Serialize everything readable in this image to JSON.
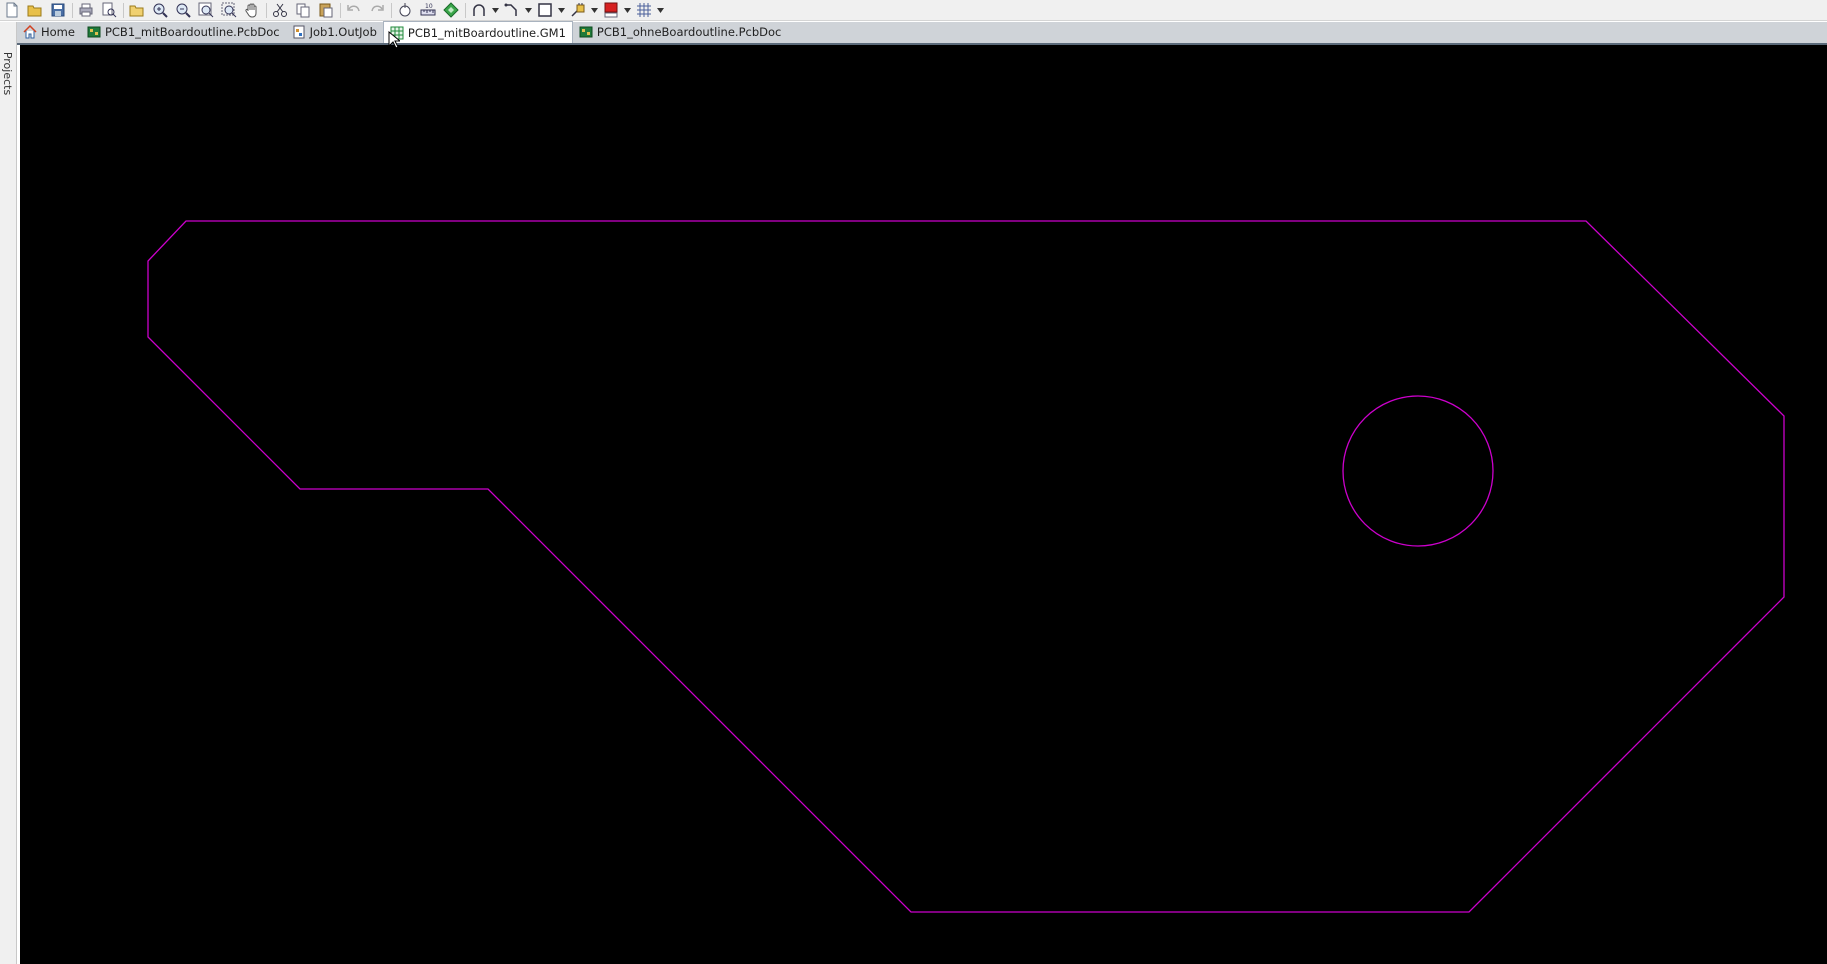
{
  "toolbar": {
    "buttons": [
      "new-file-icon",
      "open-file-icon",
      "save-icon",
      "print-icon",
      "print-preview-icon",
      "open-folder-icon",
      "zoom-in-icon",
      "zoom-out-icon",
      "zoom-fit-icon",
      "zoom-area-icon",
      "pan-hand-icon",
      "cut-icon",
      "copy-icon",
      "paste-icon",
      "undo-icon",
      "redo-icon",
      "cross-probe-icon",
      "measure-icon",
      "layer-icon",
      "arc-icon",
      "route-icon",
      "rectangle-icon",
      "component-icon",
      "color-icon",
      "grid-icon"
    ]
  },
  "side_panel": {
    "projects_label": "Projects"
  },
  "tabs": [
    {
      "label": "Home",
      "icon": "home-icon",
      "active": false
    },
    {
      "label": "PCB1_mitBoardoutline.PcbDoc",
      "icon": "pcb-doc-icon",
      "active": false
    },
    {
      "label": "Job1.OutJob",
      "icon": "outjob-icon",
      "active": false
    },
    {
      "label": "PCB1_mitBoardoutline.GM1",
      "icon": "gerber-icon",
      "active": true
    },
    {
      "label": "PCB1_ohneBoardoutline.PcbDoc",
      "icon": "pcb-doc-icon",
      "active": false
    }
  ],
  "canvas": {
    "background_color": "#000000",
    "outline_color": "#cc00cc"
  }
}
